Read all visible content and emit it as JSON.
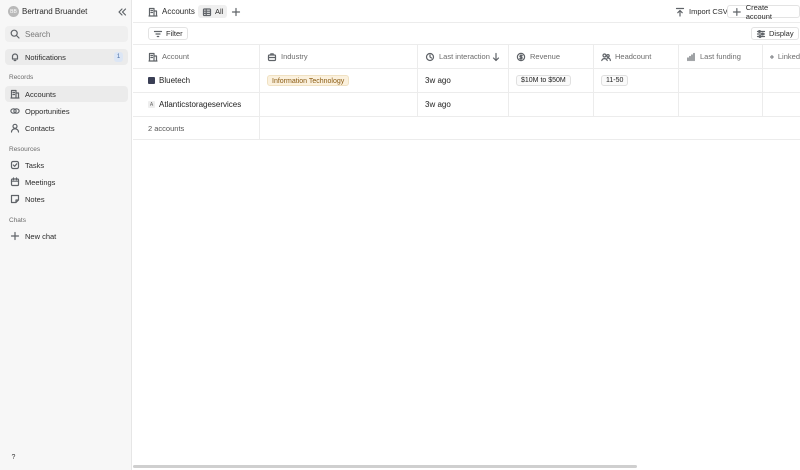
{
  "user": {
    "initials": "BB",
    "name": "Bertrand Bruandet"
  },
  "search": {
    "placeholder": "Search"
  },
  "notifications": {
    "label": "Notifications",
    "count": "1"
  },
  "sidebar": {
    "records_label": "Records",
    "records": [
      {
        "label": "Accounts",
        "icon": "building-icon",
        "active": true
      },
      {
        "label": "Opportunities",
        "icon": "link-icon"
      },
      {
        "label": "Contacts",
        "icon": "person-icon"
      }
    ],
    "resources_label": "Resources",
    "resources": [
      {
        "label": "Tasks",
        "icon": "checkbox-icon"
      },
      {
        "label": "Meetings",
        "icon": "calendar-icon"
      },
      {
        "label": "Notes",
        "icon": "note-icon"
      }
    ],
    "chats_label": "Chats",
    "new_chat": "New chat",
    "help": "?"
  },
  "topbar": {
    "object": "Accounts",
    "view": "All",
    "import_label": "Import CSV",
    "create_label": "Create account"
  },
  "toolbar": {
    "filter_label": "Filter",
    "display_label": "Display"
  },
  "table": {
    "columns": [
      {
        "label": "Account",
        "icon": "building-icon"
      },
      {
        "label": "Industry",
        "icon": "briefcase-icon"
      },
      {
        "label": "Last interaction",
        "icon": "clock-icon"
      },
      {
        "label": "Revenue",
        "icon": "dollar-icon"
      },
      {
        "label": "Headcount",
        "icon": "people-icon"
      },
      {
        "label": "Last funding",
        "icon": "bar-chart-icon"
      },
      {
        "label": "Linked",
        "icon": "globe-icon"
      }
    ],
    "rows": [
      {
        "name": "Bluetech",
        "logo": "",
        "industry": "Information Technology",
        "last_interaction": "3w ago",
        "revenue": "$10M to $50M",
        "headcount": "11-50"
      },
      {
        "name": "Atlanticstorageservices",
        "logo": "A",
        "industry": "",
        "last_interaction": "3w ago",
        "revenue": "",
        "headcount": ""
      }
    ],
    "count_label": "2 accounts"
  }
}
